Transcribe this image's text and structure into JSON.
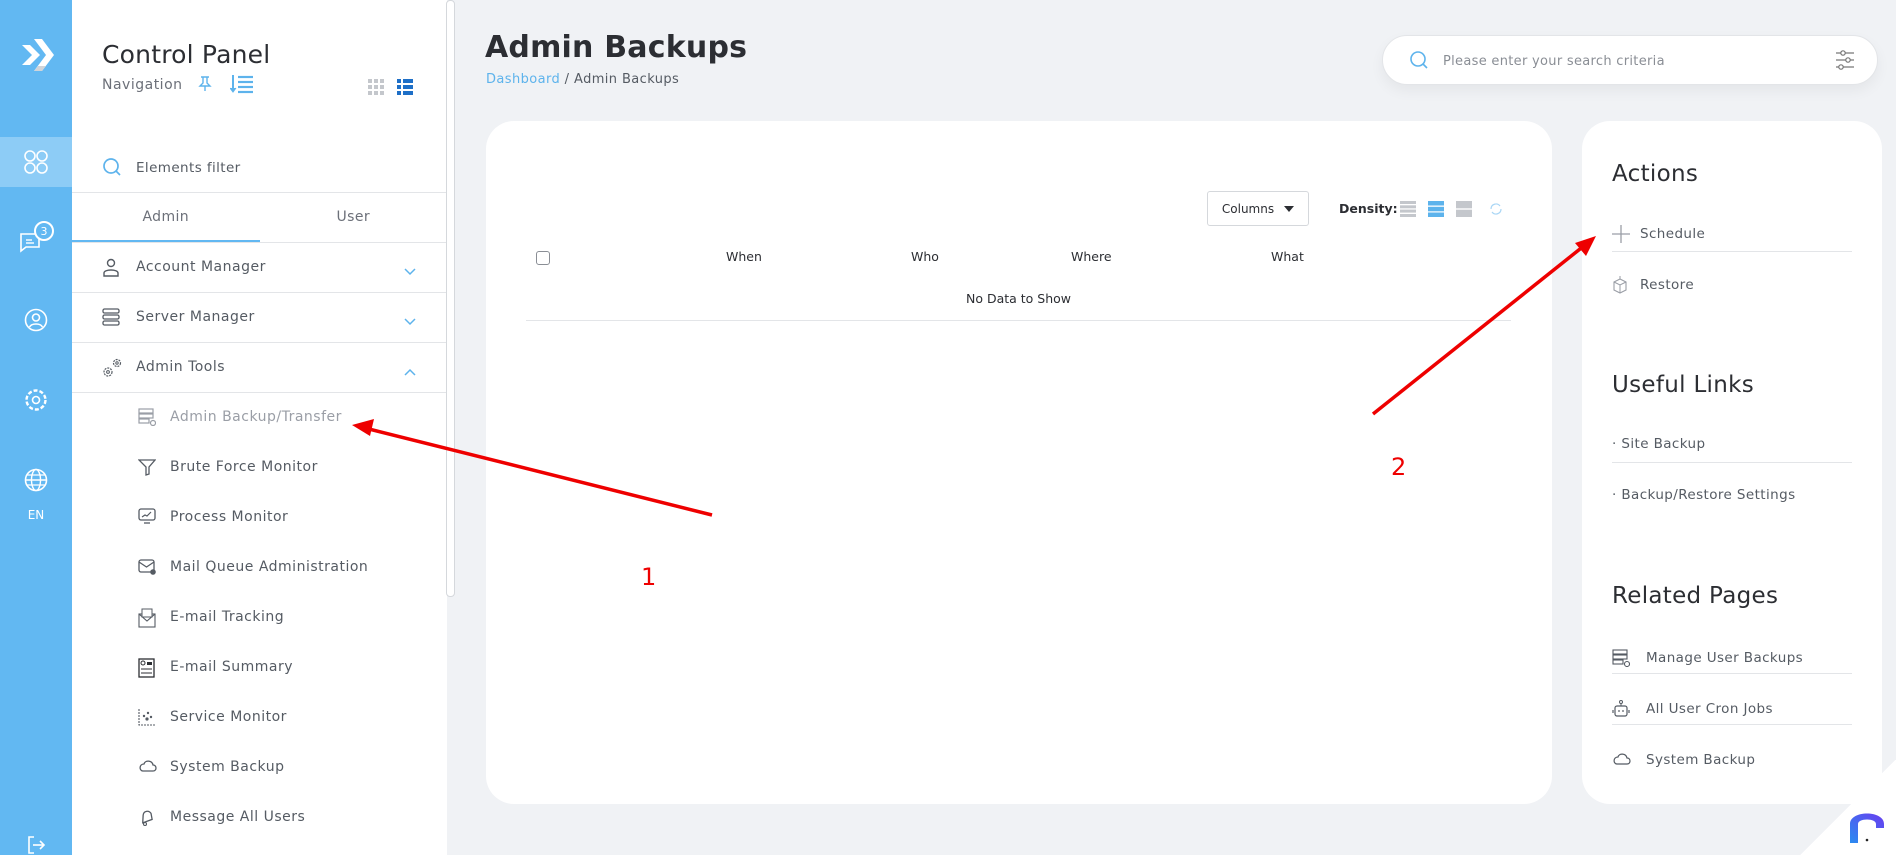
{
  "rail": {
    "items": [
      {
        "name": "dashboard",
        "icon": "apps-icon",
        "active": true
      },
      {
        "name": "messages",
        "icon": "chat-icon",
        "badge": "3"
      },
      {
        "name": "account",
        "icon": "user-circle-icon"
      },
      {
        "name": "settings",
        "icon": "gear-icon"
      },
      {
        "name": "language",
        "icon": "globe-icon"
      }
    ],
    "language": "EN",
    "logout_icon": "logout-icon"
  },
  "nav": {
    "title": "Control Panel",
    "subtitle": "Navigation",
    "filter_placeholder": "Elements filter",
    "tabs": [
      {
        "label": "Admin",
        "active": true
      },
      {
        "label": "User",
        "active": false
      }
    ],
    "groups": [
      {
        "label": "Account Manager",
        "icon": "user-icon",
        "expanded": false
      },
      {
        "label": "Server Manager",
        "icon": "server-icon",
        "expanded": false
      },
      {
        "label": "Admin Tools",
        "icon": "gears-icon",
        "expanded": true
      }
    ],
    "admin_tools": [
      {
        "label": "Admin Backup/Transfer",
        "icon": "backup-server-icon",
        "active": true
      },
      {
        "label": "Brute Force Monitor",
        "icon": "filter-icon"
      },
      {
        "label": "Process Monitor",
        "icon": "monitor-chart-icon"
      },
      {
        "label": "Mail Queue Administration",
        "icon": "mail-queue-icon"
      },
      {
        "label": "E-mail Tracking",
        "icon": "mail-tracking-icon"
      },
      {
        "label": "E-mail Summary",
        "icon": "mail-summary-icon"
      },
      {
        "label": "Service Monitor",
        "icon": "scatter-chart-icon"
      },
      {
        "label": "System Backup",
        "icon": "cloud-icon"
      },
      {
        "label": "Message All Users",
        "icon": "bell-icon"
      }
    ]
  },
  "header": {
    "title": "Admin Backups",
    "breadcrumb_link": "Dashboard",
    "breadcrumb_sep": " / ",
    "breadcrumb_current": "Admin Backups",
    "search_placeholder": "Please enter your search criteria"
  },
  "table": {
    "columns_button": "Columns",
    "density_label": "Density:",
    "density_options": [
      "compact",
      "standard",
      "comfortable"
    ],
    "density_selected": "standard",
    "headers": [
      "When",
      "Who",
      "Where",
      "What"
    ],
    "empty_message": "No Data to Show"
  },
  "side": {
    "actions_title": "Actions",
    "actions": [
      {
        "label": "Schedule",
        "icon": "plus-icon"
      },
      {
        "label": "Restore",
        "icon": "box-icon"
      }
    ],
    "links_title": "Useful Links",
    "links": [
      {
        "label": "· Site Backup"
      },
      {
        "label": "· Backup/Restore Settings"
      }
    ],
    "related_title": "Related Pages",
    "related": [
      {
        "label": "Manage User Backups",
        "icon": "backup-server-icon"
      },
      {
        "label": "All User Cron Jobs",
        "icon": "robot-icon"
      },
      {
        "label": "System Backup",
        "icon": "cloud-icon"
      }
    ]
  },
  "annotations": {
    "label_1": "1",
    "label_2": "2",
    "color": "#e00000"
  },
  "colors": {
    "accent": "#62b8f2",
    "link": "#5db3ec",
    "density_active": "#5db3ec",
    "background": "#f0f2f5"
  }
}
